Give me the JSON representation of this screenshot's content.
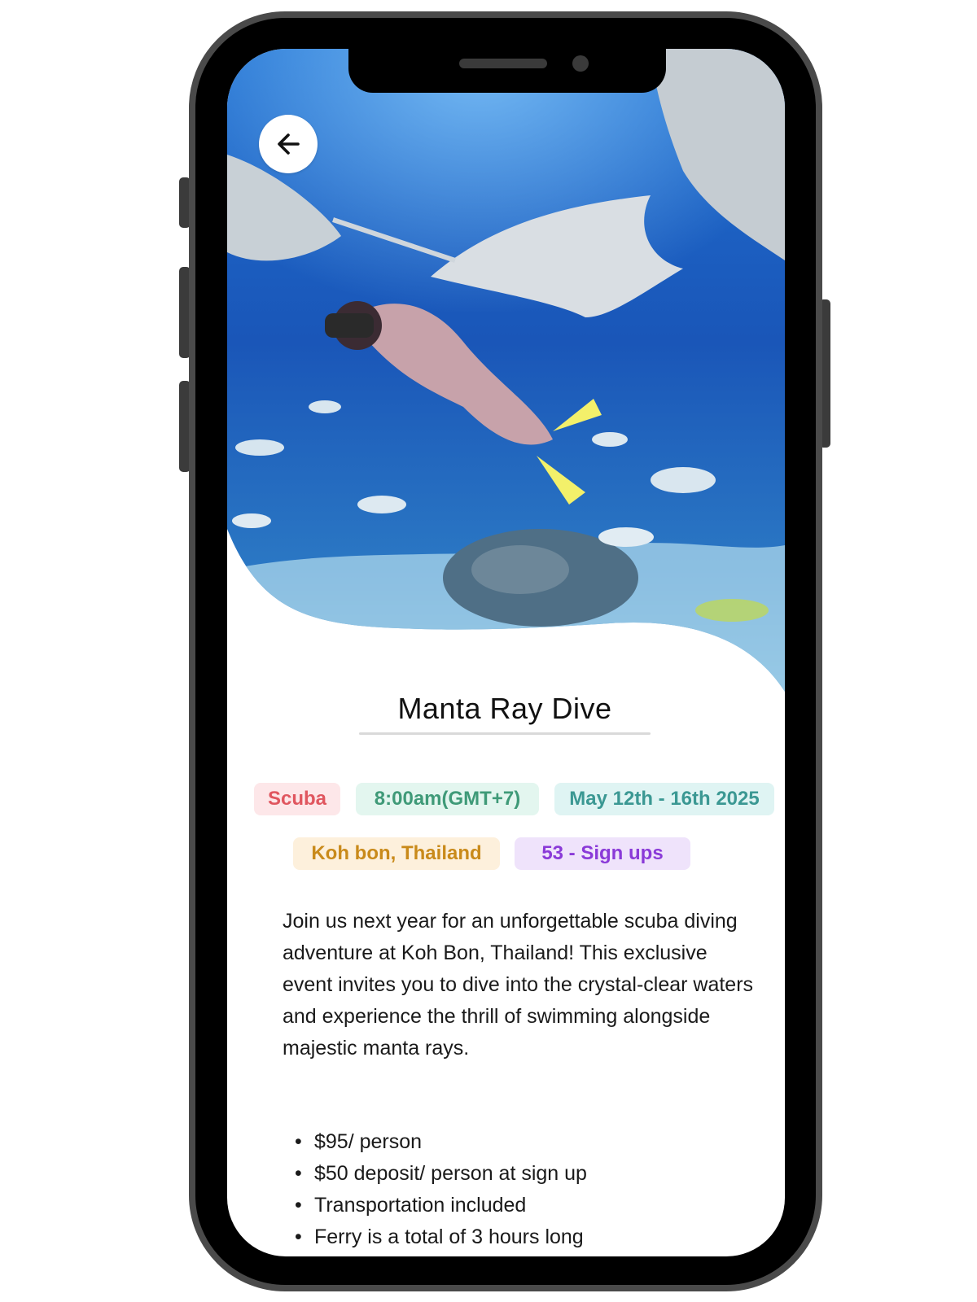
{
  "event": {
    "title": "Manta Ray Dive",
    "tags": {
      "category": "Scuba",
      "time": "8:00am(GMT+7)",
      "dates": "May 12th - 16th 2025",
      "location": "Koh bon, Thailand",
      "signups": "53 - Sign ups"
    },
    "description": "Join us next year for an unforgettable scuba diving adventure at Koh Bon, Thailand! This exclusive event invites you to dive into the crystal-clear waters and experience the thrill of swimming alongside majestic manta rays.",
    "details": [
      "$95/ person",
      "$50 deposit/ person at sign up",
      "Transportation included",
      "Ferry is a total of 3 hours long"
    ]
  },
  "icons": {
    "back": "arrow-left-icon"
  },
  "colors": {
    "scuba_bg": "#fde7e9",
    "scuba_fg": "#e0565f",
    "time_bg": "#e3f6ef",
    "time_fg": "#3f9a78",
    "dates_bg": "#dff4f3",
    "dates_fg": "#3b9893",
    "location_bg": "#fdf0dc",
    "location_fg": "#c98a1a",
    "signups_bg": "#efe3fb",
    "signups_fg": "#8a3ad8"
  }
}
